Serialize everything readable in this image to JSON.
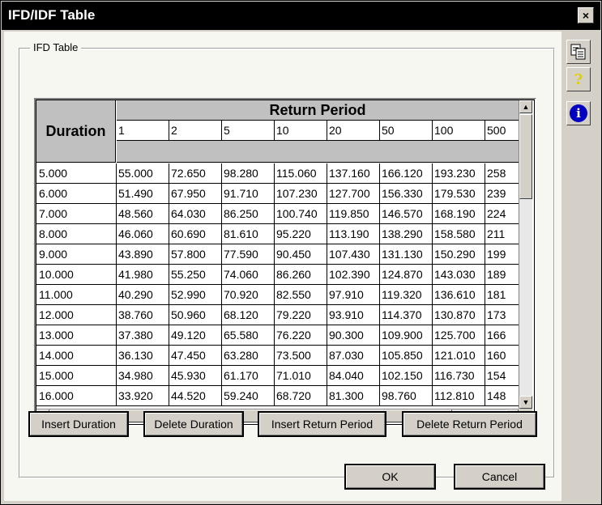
{
  "window": {
    "title": "IFD/IDF Table",
    "close_glyph": "×"
  },
  "group": {
    "label": "IFD Table"
  },
  "table": {
    "duration_header": "Duration",
    "return_period_header": "Return Period",
    "return_periods": [
      "1",
      "2",
      "5",
      "10",
      "20",
      "50",
      "100",
      "500"
    ],
    "rows": [
      {
        "duration": "5.000",
        "values": [
          "55.000",
          "72.650",
          "98.280",
          "115.060",
          "137.160",
          "166.120",
          "193.230",
          "258"
        ]
      },
      {
        "duration": "6.000",
        "values": [
          "51.490",
          "67.950",
          "91.710",
          "107.230",
          "127.700",
          "156.330",
          "179.530",
          "239"
        ]
      },
      {
        "duration": "7.000",
        "values": [
          "48.560",
          "64.030",
          "86.250",
          "100.740",
          "119.850",
          "146.570",
          "168.190",
          "224"
        ]
      },
      {
        "duration": "8.000",
        "values": [
          "46.060",
          "60.690",
          "81.610",
          "95.220",
          "113.190",
          "138.290",
          "158.580",
          "211"
        ]
      },
      {
        "duration": "9.000",
        "values": [
          "43.890",
          "57.800",
          "77.590",
          "90.450",
          "107.430",
          "131.130",
          "150.290",
          "199"
        ]
      },
      {
        "duration": "10.000",
        "values": [
          "41.980",
          "55.250",
          "74.060",
          "86.260",
          "102.390",
          "124.870",
          "143.030",
          "189"
        ]
      },
      {
        "duration": "11.000",
        "values": [
          "40.290",
          "52.990",
          "70.920",
          "82.550",
          "97.910",
          "119.320",
          "136.610",
          "181"
        ]
      },
      {
        "duration": "12.000",
        "values": [
          "38.760",
          "50.960",
          "68.120",
          "79.220",
          "93.910",
          "114.370",
          "130.870",
          "173"
        ]
      },
      {
        "duration": "13.000",
        "values": [
          "37.380",
          "49.120",
          "65.580",
          "76.220",
          "90.300",
          "109.900",
          "125.700",
          "166"
        ]
      },
      {
        "duration": "14.000",
        "values": [
          "36.130",
          "47.450",
          "63.280",
          "73.500",
          "87.030",
          "105.850",
          "121.010",
          "160"
        ]
      },
      {
        "duration": "15.000",
        "values": [
          "34.980",
          "45.930",
          "61.170",
          "71.010",
          "84.040",
          "102.150",
          "116.730",
          "154"
        ]
      },
      {
        "duration": "16.000",
        "values": [
          "33.920",
          "44.520",
          "59.240",
          "68.720",
          "81.300",
          "98.760",
          "112.810",
          "148"
        ]
      }
    ]
  },
  "buttons": {
    "insert_duration": "Insert Duration",
    "delete_duration": "Delete Duration",
    "insert_return_period": "Insert Return Period",
    "delete_return_period": "Delete Return Period",
    "ok": "OK",
    "cancel": "Cancel"
  },
  "toolbar": {
    "copy_icon": "copy-icon",
    "help_icon": "help-icon",
    "info_icon": "info-icon",
    "help_glyph": "?",
    "info_glyph": "i"
  },
  "scroll": {
    "up": "▲",
    "down": "▼",
    "left": "◄",
    "right": "►"
  }
}
